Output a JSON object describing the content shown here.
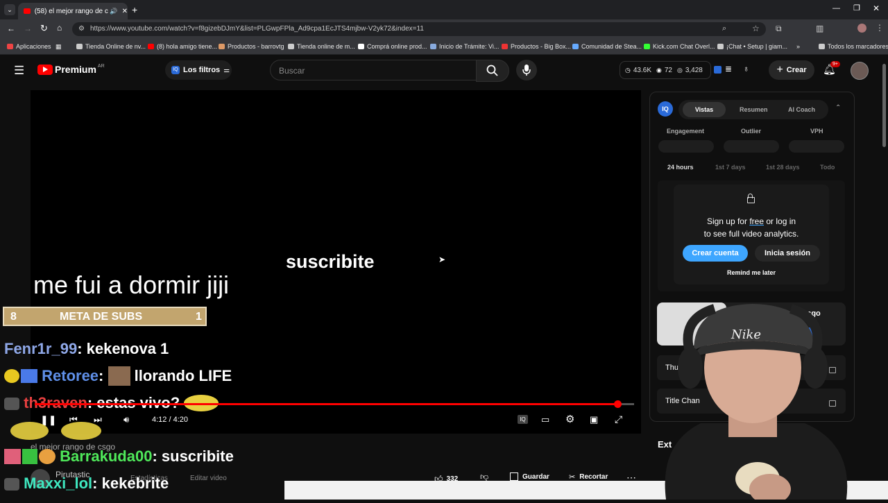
{
  "browser": {
    "tab_title": "(58) el mejor rango de csgo",
    "url": "https://www.youtube.com/watch?v=f8gizebDJmY&list=PLGwpFPla_Ad9cpa1EcJTS4mjbw-V2yk72&index=11",
    "bookmarks": [
      "Aplicaciones",
      "Tienda Online de nv...",
      "(8) hola amigo tiene...",
      "Productos - barrovtg",
      "Tienda online de m...",
      "Comprá online prod...",
      "Inicio de Trámite: Vi...",
      "Productos - Big Box...",
      "Comunidad de Stea...",
      "Kick.com Chat Overl...",
      "¡Chat • Setup | giam..."
    ],
    "all_bookmarks": "Todos los marcadores"
  },
  "header": {
    "logo": "Premium",
    "country": "AR",
    "filters": "Los filtros",
    "search_placeholder": "Buscar",
    "stat1": "43.6K",
    "stat2": "72",
    "stat3": "3,428",
    "create": "Crear",
    "notif_count": "9+"
  },
  "video": {
    "caption_center": "suscribite",
    "caption_left": "me fui a dormir jiji",
    "meta_left": "8",
    "meta_label": "META DE SUBS",
    "meta_right": "1",
    "time": "4:12 / 4:20",
    "progress": 0.97,
    "chat": [
      {
        "user": "Fenr1r_99",
        "msg": "kekenova 1",
        "color": "#8fa8e8"
      },
      {
        "user": "Retoree",
        "msg": "llorando LIFE",
        "color": "#5f8fe8"
      },
      {
        "user": "th3raven",
        "msg": "estas vivo?",
        "color": "#e84040"
      },
      {
        "user": "Barrakuda00",
        "msg": "suscribite",
        "color": "#4fe85a"
      },
      {
        "user": "Maxxi_lol",
        "msg": "kekebrite",
        "color": "#3fe8c0"
      }
    ],
    "title_under": "el mejor rango de csgo",
    "channel": "Pirutastic",
    "estadisticas": "Estadísticas",
    "editar": "Editar video"
  },
  "actions": {
    "likes": "332",
    "save": "Guardar",
    "clip": "Recortar"
  },
  "panel": {
    "tabs": [
      "Vistas",
      "Resumen",
      "AI Coach"
    ],
    "metrics": [
      "Engagement",
      "Outlier",
      "VPH"
    ],
    "ranges": [
      "24 hours",
      "1st 7 days",
      "1st 28 days",
      "Todo"
    ],
    "modal_line1_a": "Sign up for",
    "modal_line1_link": "free",
    "modal_line1_b": "or log in",
    "modal_line2": "to see full video analytics.",
    "create_account": "Crear cuenta",
    "login": "Inicia sesión",
    "remind": "Remind me later",
    "card_title": "ngo de csgo",
    "thumb_label": "Thum",
    "title_label": "Title Chan",
    "ext_label": "Ext"
  },
  "cam": {
    "cap_text": "Nike"
  }
}
